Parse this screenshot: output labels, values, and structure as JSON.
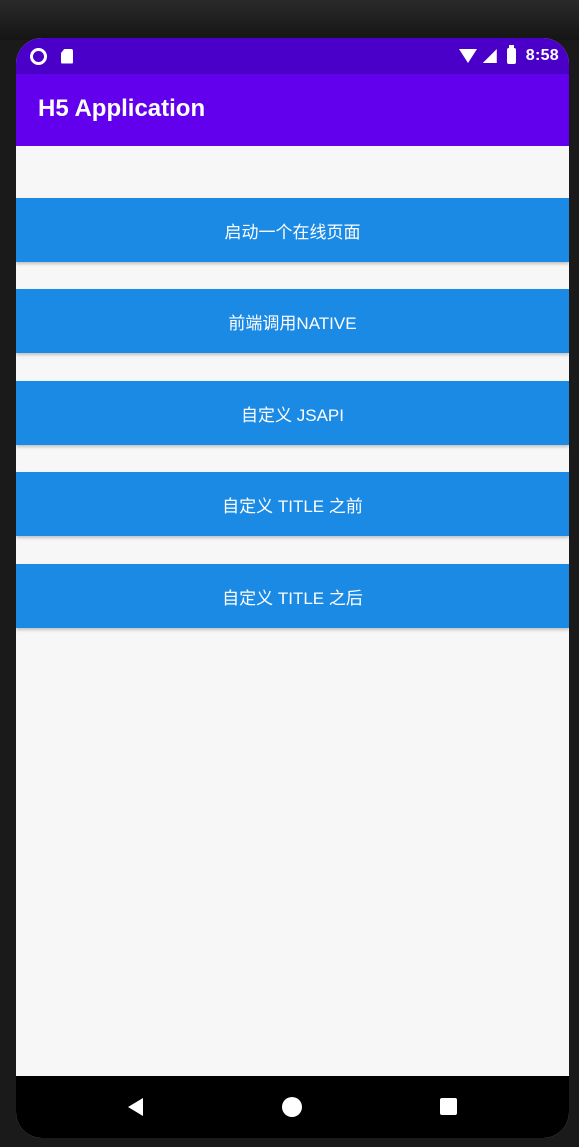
{
  "status_bar": {
    "time": "8:58",
    "icons": [
      "notification-ring-icon",
      "sd-card-icon",
      "wifi-icon",
      "cell-signal-icon",
      "battery-icon"
    ]
  },
  "app_bar": {
    "title": "H5 Application"
  },
  "buttons": [
    {
      "label": "启动一个在线页面"
    },
    {
      "label": "前端调用NATIVE"
    },
    {
      "label": "自定义 JSAPI"
    },
    {
      "label": "自定义 TITLE 之前"
    },
    {
      "label": "自定义 TITLE 之后"
    }
  ],
  "navigation_bar": {
    "icons": [
      "back-icon",
      "home-icon",
      "recents-icon"
    ]
  },
  "colors": {
    "status_bar": "#4a00c8",
    "app_bar": "#6200ee",
    "button": "#1a8ae5",
    "background": "#f7f7f7",
    "nav_bar": "#000000"
  }
}
